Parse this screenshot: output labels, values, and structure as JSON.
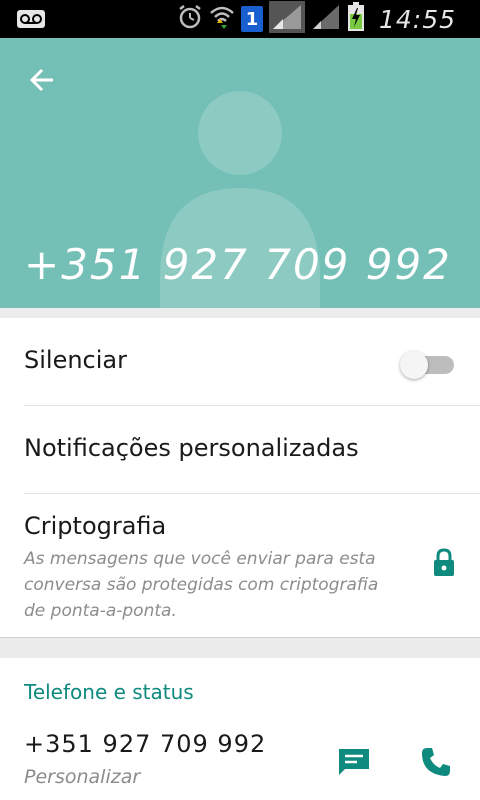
{
  "status_bar": {
    "time": "14:55",
    "sim_slot": "1",
    "icons": [
      "voicemail-icon",
      "alarm-icon",
      "wifi-icon",
      "sim-badge",
      "signal-icon",
      "signal-icon",
      "battery-charging-icon"
    ]
  },
  "header": {
    "title": "+351 927 709 992",
    "back_icon": "arrow-back-icon",
    "avatar_icon": "default-avatar-icon",
    "background_color": "#74bfb6"
  },
  "settings": {
    "mute_label": "Silenciar",
    "mute_enabled": false,
    "custom_notifications_label": "Notificações personalizadas",
    "encryption_label": "Criptografia",
    "encryption_description": "As mensagens que você enviar para esta conversa são protegidas com criptografia de ponta-a-ponta.",
    "encryption_icon": "lock-icon"
  },
  "phone_section": {
    "title": "Telefone e status",
    "number": "+351 927 709 992",
    "status": "Personalizar",
    "message_icon": "message-icon",
    "call_icon": "phone-icon",
    "accent_color": "#0f8a7e"
  }
}
